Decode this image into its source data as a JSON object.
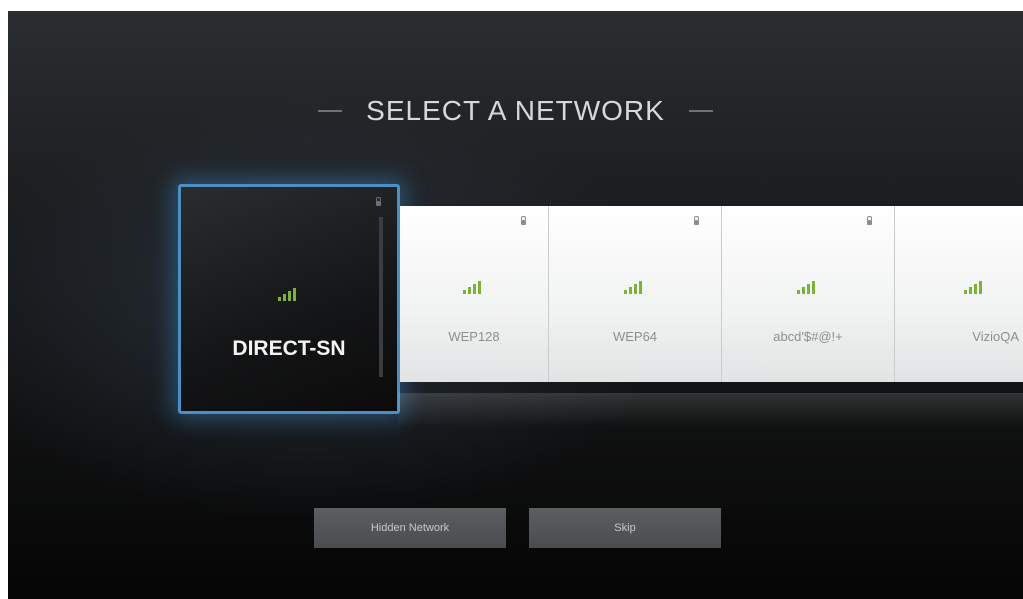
{
  "screen": {
    "title": "SELECT A NETWORK"
  },
  "networks": [
    {
      "name": "DIRECT-SN",
      "secured": true,
      "signal": "full",
      "selected": true
    },
    {
      "name": "WEP128",
      "secured": true,
      "signal": "full",
      "selected": false
    },
    {
      "name": "WEP64",
      "secured": true,
      "signal": "full",
      "selected": false
    },
    {
      "name": "abcd'$#@!+",
      "secured": true,
      "signal": "full",
      "selected": false
    },
    {
      "name": "VizioQA",
      "secured": false,
      "signal": "full",
      "selected": false
    }
  ],
  "buttons": {
    "hidden_network_label": "Hidden Network",
    "skip_label": "Skip"
  },
  "colors": {
    "accent_focus": "#4c8fc4",
    "signal_green": "#7db23a"
  },
  "icons": {
    "signal": "wifi-signal-icon",
    "lock": "lock-icon"
  }
}
